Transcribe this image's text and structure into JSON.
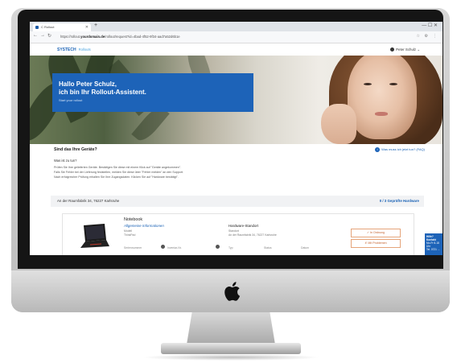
{
  "browser": {
    "tab_title": "C Rollout",
    "url_prefix": "https://rollout.",
    "url_host": "yourdomain.de",
    "url_path": "/rollout/request?id=4bad-4f52-9f34-aad7a52d6b1e",
    "window_controls": "—  ☐  ✕"
  },
  "site": {
    "logo_text": "SYSTECH",
    "logo_claim": "Rollouts",
    "user_name": "Peter Schulz"
  },
  "hero": {
    "title_line1": "Hallo Peter Schulz,",
    "title_line2": "ich bin Ihr Rollout-Assistent.",
    "subtitle": "Start your rollout"
  },
  "content": {
    "question": "Sind das Ihre Geräte?",
    "help_link": "Was muss ich jetzt tun? (FAQ)",
    "instructions_title": "Was ist zu tun?",
    "instructions": [
      "Prüfen Sie Ihre gelieferten Geräte. Bestätigen Sie diese mit einem Klick auf \"Geräte angekommen\".",
      "Falls Sie Fehler bei der Lieferung feststellen, melden Sie diese über \"Fehler melden\" an den Support.",
      "Nach erfolgreicher Prüfung erhalten Sie Ihre Zugangsdaten. Klicken Sie auf \"Hardware bestätigt\"."
    ],
    "address": "An der Raumfabrik 34, 76227 Karlsruhe",
    "hardware_count": "0 / 3 Geprüfte Hardware"
  },
  "device": {
    "type": "Notebook",
    "section_label": "Allgemeine Informationen",
    "meta_label": "Modell",
    "meta_value": "ThinkPad",
    "status_label": "Hardware-Standort",
    "status_meta": "Standort",
    "status_value": "An der Raumfabrik 34, 76227 Karlsruhe",
    "field_labels": [
      "Seriennummer",
      "Inventar-Nr."
    ],
    "field_labels_right": [
      "Typ",
      "Status",
      "Datum"
    ],
    "btn_ok": "✓ In Ordnung",
    "btn_defect": "✗ Mit Problemen"
  },
  "chat": {
    "title": "Hilfe? Kontakt",
    "line1": "Mo-Fr 8-18 Uhr",
    "line2": "Tel. 0721 ..."
  }
}
